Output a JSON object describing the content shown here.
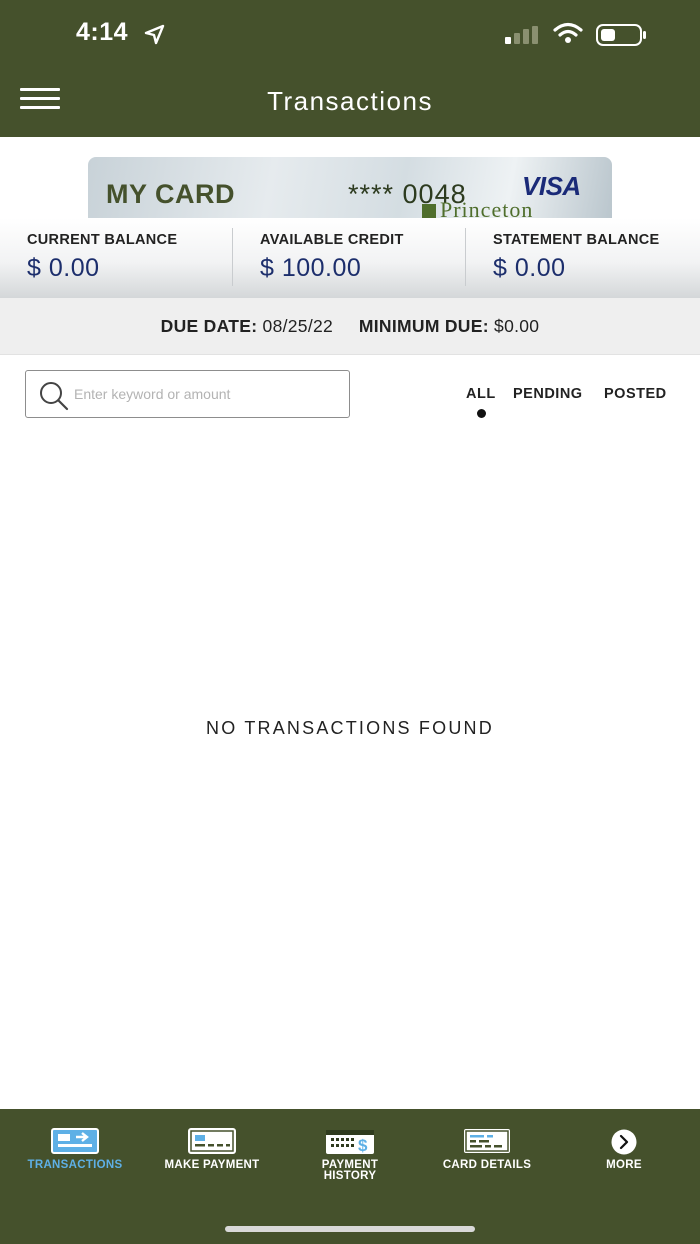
{
  "status_bar": {
    "time": "4:14"
  },
  "header": {
    "title": "Transactions"
  },
  "card": {
    "name": "MY CARD",
    "number": "**** 0048",
    "network": "VISA",
    "issuer": "Princeton"
  },
  "balances": [
    {
      "label": "CURRENT BALANCE",
      "value": "$ 0.00"
    },
    {
      "label": "AVAILABLE CREDIT",
      "value": "$ 100.00"
    },
    {
      "label": "STATEMENT BALANCE",
      "value": "$ 0.00"
    }
  ],
  "due": {
    "due_date_label": "DUE DATE:",
    "due_date": "08/25/22",
    "min_due_label": "MINIMUM DUE:",
    "min_due": "$0.00"
  },
  "search": {
    "placeholder": "Enter keyword or amount",
    "value": ""
  },
  "filters": {
    "items": [
      "ALL",
      "PENDING",
      "POSTED"
    ],
    "selected": "ALL"
  },
  "empty_message": "NO TRANSACTIONS FOUND",
  "bottom_nav": {
    "items": [
      {
        "label": "TRANSACTIONS",
        "icon": "transactions-icon",
        "active": true
      },
      {
        "label": "MAKE PAYMENT",
        "icon": "payment-card-icon",
        "active": false
      },
      {
        "label": "PAYMENT",
        "label2": "HISTORY",
        "icon": "payment-history-icon",
        "active": false
      },
      {
        "label": "CARD DETAILS",
        "icon": "card-details-icon",
        "active": false
      },
      {
        "label": "MORE",
        "icon": "chevron-right-circle-icon",
        "active": false
      }
    ]
  },
  "colors": {
    "brand_green": "#45512c",
    "active_blue": "#5eb0e6",
    "balance_value": "#1c2e6c"
  }
}
